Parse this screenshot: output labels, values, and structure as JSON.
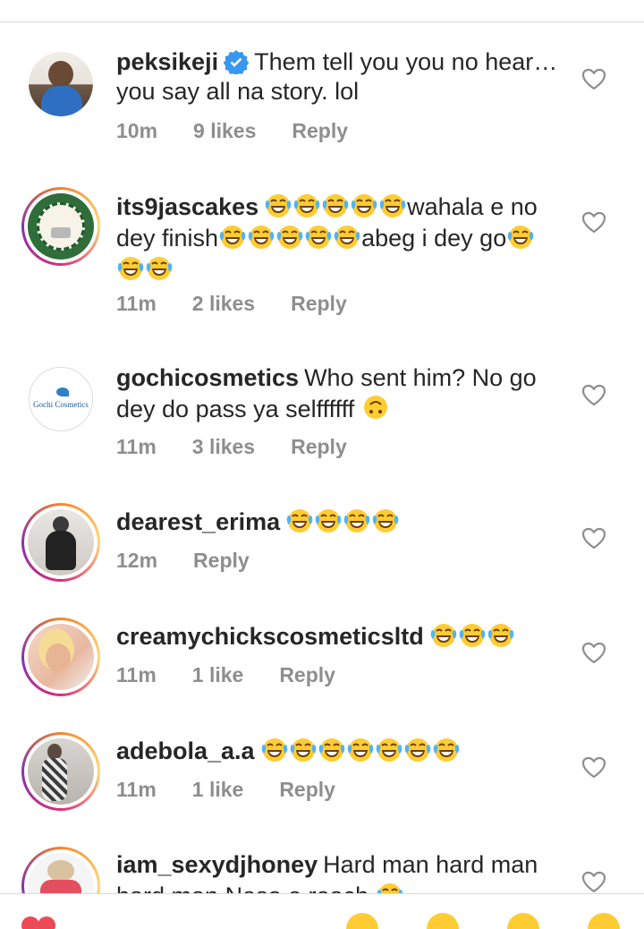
{
  "icons": {
    "like": "heart-outline-icon",
    "verified": "verified-badge-icon",
    "emoji": "face-with-tears-of-joy",
    "upside": "upside-down-face"
  },
  "comments": [
    {
      "username": "peksikeji",
      "text": "Them tell you you no hear… you  say all na story. lol",
      "time": "10m",
      "likes": "9 likes",
      "reply": "Reply"
    },
    {
      "username": "its9jascakes",
      "text_a": "wahala e no dey finish",
      "text_b": "abeg i dey go",
      "time": "11m",
      "likes": "2 likes",
      "reply": "Reply"
    },
    {
      "username": "gochicosmetics",
      "text": "Who sent him? No go dey do pass ya selffffff",
      "time": "11m",
      "likes": "3 likes",
      "reply": "Reply",
      "avatar_text": "Gochi Cosmetics"
    },
    {
      "username": "dearest_erima",
      "time": "12m",
      "reply": "Reply"
    },
    {
      "username": "creamychickscosmeticsltd",
      "time": "11m",
      "likes": "1 like",
      "reply": "Reply"
    },
    {
      "username": "adebola_a.a",
      "time": "11m",
      "likes": "1 like",
      "reply": "Reply"
    },
    {
      "username": "iam_sexydjhoney",
      "text": "Hard man hard man hard man Naso e reach"
    }
  ]
}
